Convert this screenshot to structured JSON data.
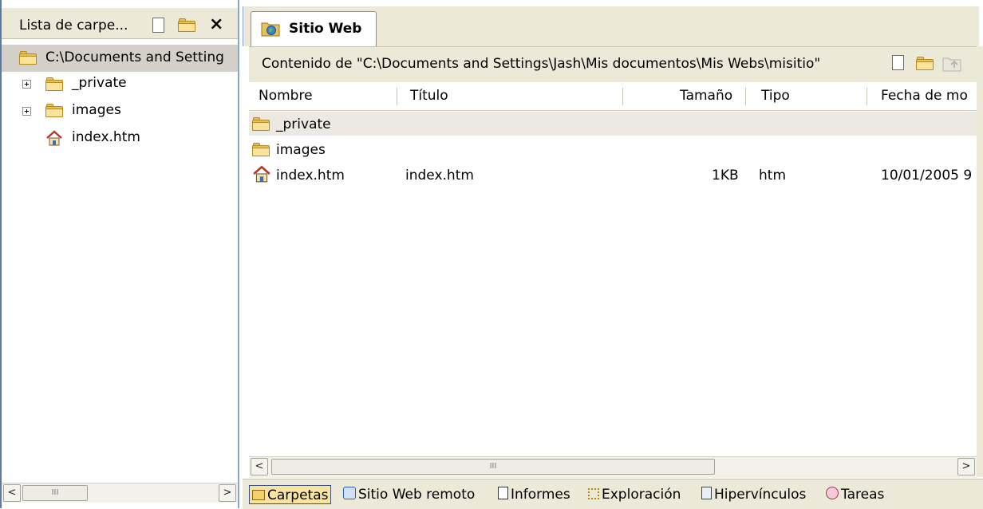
{
  "folder_list": {
    "title": "Lista de carpe...",
    "root_path": "C:\\Documents and Setting",
    "items": [
      {
        "label": "_private",
        "type": "folder",
        "expandable": true
      },
      {
        "label": "images",
        "type": "folder",
        "expandable": true
      },
      {
        "label": "index.htm",
        "type": "home-page",
        "expandable": false
      }
    ],
    "close_label": "×"
  },
  "tab": {
    "label": "Sitio Web"
  },
  "content": {
    "label": "Contenido de \"C:\\Documents and Settings\\Jash\\Mis documentos\\Mis Webs\\misitio\""
  },
  "columns": [
    "Nombre",
    "Título",
    "Tamaño",
    "Tipo",
    "Fecha de mo"
  ],
  "rows": [
    {
      "name": "_private",
      "title": "",
      "size": "",
      "type": "",
      "date": "",
      "icon": "folder-icon"
    },
    {
      "name": "images",
      "title": "",
      "size": "",
      "type": "",
      "date": "",
      "icon": "folder-icon"
    },
    {
      "name": "index.htm",
      "title": "index.htm",
      "size": "1KB",
      "type": "htm",
      "date": "10/01/2005 9",
      "icon": "home-page-icon"
    }
  ],
  "scroll": {
    "left_arrow": "<",
    "right_arrow": ">",
    "grip": "III"
  },
  "views": [
    {
      "label": "Carpetas",
      "icon": "folder-icon"
    },
    {
      "label": "Sitio Web remoto",
      "icon": "remote-site-icon"
    },
    {
      "label": "Informes",
      "icon": "reports-icon"
    },
    {
      "label": "Exploración",
      "icon": "navigation-icon"
    },
    {
      "label": "Hipervínculos",
      "icon": "hyperlinks-icon"
    },
    {
      "label": "Tareas",
      "icon": "tasks-icon"
    }
  ],
  "colors": {
    "selection": "#ece9e3",
    "panel": "#ece9d8",
    "folder": "#e8c25a",
    "accent_border": "#3b4f7f"
  }
}
